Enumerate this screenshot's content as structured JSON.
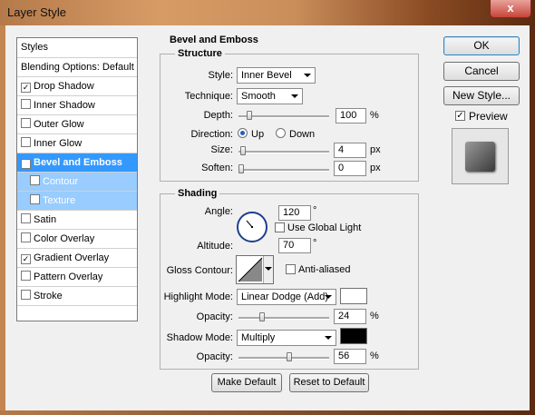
{
  "window": {
    "title": "Layer Style",
    "close_label": "x"
  },
  "styles_list": {
    "header": "Styles",
    "items": [
      {
        "label": "Blending Options: Default",
        "checkbox": false,
        "checked": false
      },
      {
        "label": "Drop Shadow",
        "checkbox": true,
        "checked": true
      },
      {
        "label": "Inner Shadow",
        "checkbox": true,
        "checked": false
      },
      {
        "label": "Outer Glow",
        "checkbox": true,
        "checked": false
      },
      {
        "label": "Inner Glow",
        "checkbox": true,
        "checked": false
      },
      {
        "label": "Bevel and Emboss",
        "checkbox": true,
        "checked": true,
        "selected": true
      },
      {
        "label": "Contour",
        "checkbox": true,
        "checked": false,
        "sub": true
      },
      {
        "label": "Texture",
        "checkbox": true,
        "checked": false,
        "sub": true
      },
      {
        "label": "Satin",
        "checkbox": true,
        "checked": false
      },
      {
        "label": "Color Overlay",
        "checkbox": true,
        "checked": false
      },
      {
        "label": "Gradient Overlay",
        "checkbox": true,
        "checked": true
      },
      {
        "label": "Pattern Overlay",
        "checkbox": true,
        "checked": false
      },
      {
        "label": "Stroke",
        "checkbox": true,
        "checked": false
      }
    ]
  },
  "bevel": {
    "title": "Bevel and Emboss",
    "structure": {
      "title": "Structure",
      "style_label": "Style:",
      "style_value": "Inner Bevel",
      "technique_label": "Technique:",
      "technique_value": "Smooth",
      "depth_label": "Depth:",
      "depth_value": "100",
      "depth_unit": "%",
      "depth_level": 0.1,
      "direction_label": "Direction:",
      "direction_up": "Up",
      "direction_down": "Down",
      "direction_selected": "Up",
      "size_label": "Size:",
      "size_value": "4",
      "size_unit": "px",
      "size_level": 0.02,
      "soften_label": "Soften:",
      "soften_value": "0",
      "soften_unit": "px",
      "soften_level": 0.0
    },
    "shading": {
      "title": "Shading",
      "angle_label": "Angle:",
      "angle_value": "120",
      "angle_unit": "°",
      "global_light_label": "Use Global Light",
      "global_light_checked": false,
      "altitude_label": "Altitude:",
      "altitude_value": "70",
      "altitude_unit": "°",
      "gloss_label": "Gloss Contour:",
      "anti_aliased_label": "Anti-aliased",
      "anti_aliased_checked": false,
      "highlight_mode_label": "Highlight Mode:",
      "highlight_mode_value": "Linear Dodge (Add)",
      "highlight_color": "#ffffff",
      "highlight_opacity_label": "Opacity:",
      "highlight_opacity_value": "24",
      "highlight_opacity_unit": "%",
      "highlight_opacity_level": 0.24,
      "shadow_mode_label": "Shadow Mode:",
      "shadow_mode_value": "Multiply",
      "shadow_color": "#000000",
      "shadow_opacity_label": "Opacity:",
      "shadow_opacity_value": "56",
      "shadow_opacity_unit": "%",
      "shadow_opacity_level": 0.56
    },
    "make_default_label": "Make Default",
    "reset_default_label": "Reset to Default"
  },
  "actions": {
    "ok_label": "OK",
    "cancel_label": "Cancel",
    "new_style_label": "New Style...",
    "preview_label": "Preview",
    "preview_checked": true
  }
}
